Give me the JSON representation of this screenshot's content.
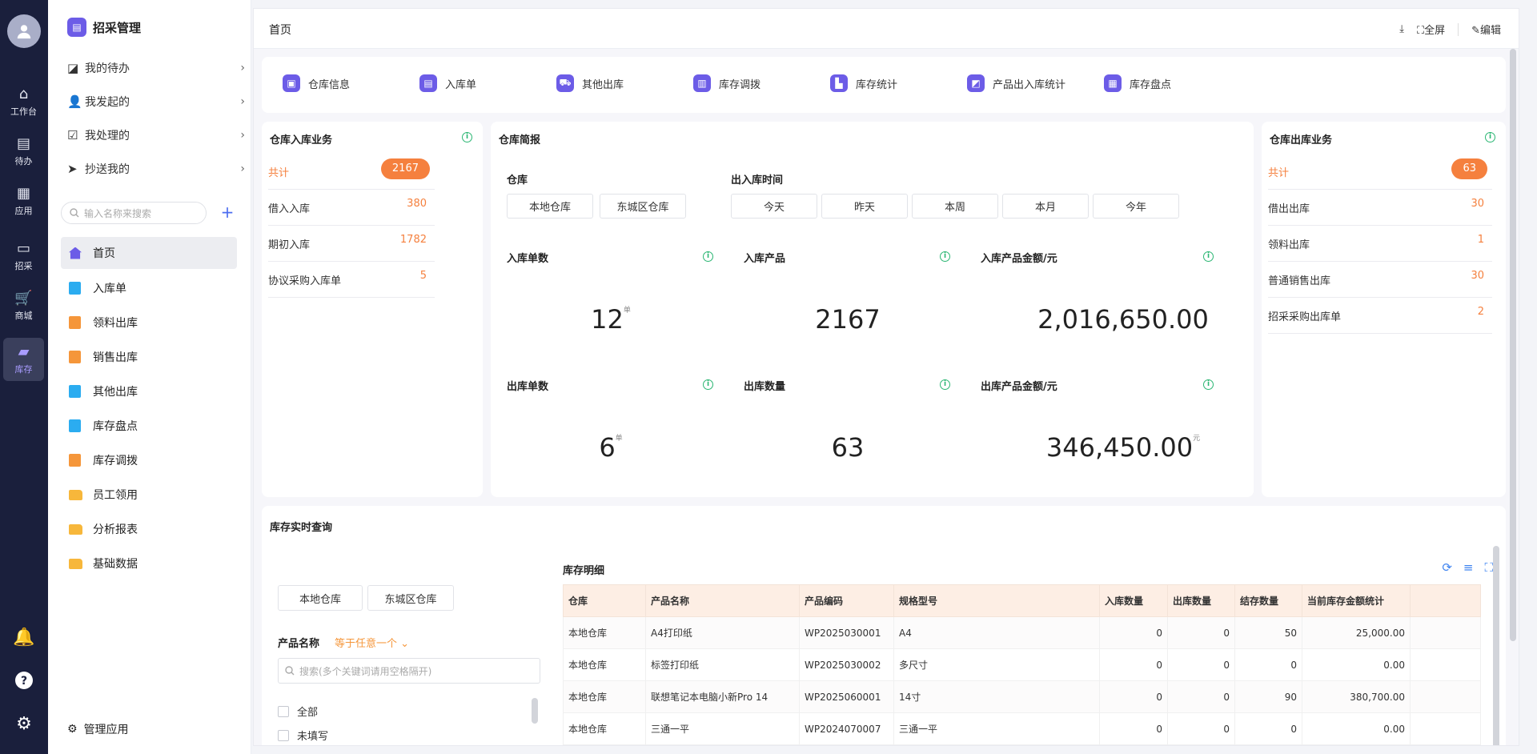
{
  "rail": {
    "items": [
      {
        "label": "工作台",
        "icon": "home-icon"
      },
      {
        "label": "待办",
        "icon": "clipboard-icon"
      },
      {
        "label": "应用",
        "icon": "apps-icon"
      },
      {
        "label": "招采",
        "icon": "procurement-icon"
      },
      {
        "label": "商城",
        "icon": "cart-icon"
      },
      {
        "label": "库存",
        "icon": "warehouse-icon"
      }
    ],
    "active": "库存"
  },
  "menu": {
    "title": "招采管理",
    "todos": [
      {
        "label": "我的待办",
        "icon": "todo-icon"
      },
      {
        "label": "我发起的",
        "icon": "user-add-icon"
      },
      {
        "label": "我处理的",
        "icon": "checkbox-icon"
      },
      {
        "label": "抄送我的",
        "icon": "send-icon"
      }
    ],
    "search_placeholder": "输入名称来搜索",
    "nav": [
      {
        "label": "首页",
        "icon": "home-icon",
        "color": "#6c5ce7"
      },
      {
        "label": "入库单",
        "icon": "form-icon",
        "color": "#2bacf0"
      },
      {
        "label": "领料出库",
        "icon": "grid-form-icon",
        "color": "#f5963a"
      },
      {
        "label": "销售出库",
        "icon": "grid-form-icon",
        "color": "#f5963a"
      },
      {
        "label": "其他出库",
        "icon": "form-icon",
        "color": "#2bacf0"
      },
      {
        "label": "库存盘点",
        "icon": "form-icon",
        "color": "#2bacf0"
      },
      {
        "label": "库存调拨",
        "icon": "grid-form-icon",
        "color": "#f5963a"
      },
      {
        "label": "员工领用",
        "icon": "folder-icon",
        "color": "#f7b73b"
      },
      {
        "label": "分析报表",
        "icon": "folder-icon",
        "color": "#f7b73b"
      },
      {
        "label": "基础数据",
        "icon": "folder-icon",
        "color": "#f7b73b"
      }
    ],
    "active": "首页",
    "manage_label": "管理应用"
  },
  "topbar": {
    "title": "首页",
    "fullscreen_label": "全屏",
    "edit_label": "编辑"
  },
  "quick_links": [
    {
      "label": "仓库信息"
    },
    {
      "label": "入库单"
    },
    {
      "label": "其他出库"
    },
    {
      "label": "库存调拨"
    },
    {
      "label": "库存统计"
    },
    {
      "label": "产品出入库统计"
    },
    {
      "label": "库存盘点"
    }
  ],
  "inbound": {
    "title": "仓库入库业务",
    "total_label": "共计",
    "total_value": "2167",
    "rows": [
      {
        "label": "借入入库",
        "value": "380"
      },
      {
        "label": "期初入库",
        "value": "1782"
      },
      {
        "label": "协议采购入库单",
        "value": "5"
      }
    ]
  },
  "outbound": {
    "title": "仓库出库业务",
    "total_label": "共计",
    "total_value": "63",
    "rows": [
      {
        "label": "借出出库",
        "value": "30"
      },
      {
        "label": "领料出库",
        "value": "1"
      },
      {
        "label": "普通销售出库",
        "value": "30"
      },
      {
        "label": "招采采购出库单",
        "value": "2"
      }
    ]
  },
  "brief": {
    "title": "仓库简报",
    "warehouse_label": "仓库",
    "warehouses": [
      "本地仓库",
      "东城区仓库"
    ],
    "time_label": "出入库时间",
    "times": [
      "今天",
      "昨天",
      "本周",
      "本月",
      "今年"
    ],
    "stats": [
      {
        "label": "入库单数",
        "value": "12",
        "unit": "单"
      },
      {
        "label": "入库产品",
        "value": "2167",
        "unit": ""
      },
      {
        "label": "入库产品金额/元",
        "value": "2,016,650.00",
        "unit": ""
      },
      {
        "label": "出库单数",
        "value": "6",
        "unit": "单"
      },
      {
        "label": "出库数量",
        "value": "63",
        "unit": ""
      },
      {
        "label": "出库产品金额/元",
        "value": "346,450.00",
        "unit": "元"
      }
    ]
  },
  "realtime": {
    "title": "库存实时查询",
    "warehouses": [
      "本地仓库",
      "东城区仓库"
    ],
    "filter_label": "产品名称",
    "filter_op": "等于任意一个",
    "search_placeholder": "搜索(多个关键词请用空格隔开)",
    "options": [
      "全部",
      "未填写"
    ],
    "detail_title": "库存明细",
    "columns": [
      "仓库",
      "产品名称",
      "产品编码",
      "规格型号",
      "入库数量",
      "出库数量",
      "结存数量",
      "当前库存金额统计"
    ],
    "rows": [
      [
        "本地仓库",
        "A4打印纸",
        "WP2025030001",
        "A4",
        "0",
        "0",
        "50",
        "25,000.00"
      ],
      [
        "本地仓库",
        "标签打印纸",
        "WP2025030002",
        "多尺寸",
        "0",
        "0",
        "0",
        "0.00"
      ],
      [
        "本地仓库",
        "联想笔记本电脑小新Pro 14",
        "WP2025060001",
        "14寸",
        "0",
        "0",
        "90",
        "380,700.00"
      ],
      [
        "本地仓库",
        "三通一平",
        "WP2024070007",
        "三通一平",
        "0",
        "0",
        "0",
        "0.00"
      ]
    ]
  }
}
